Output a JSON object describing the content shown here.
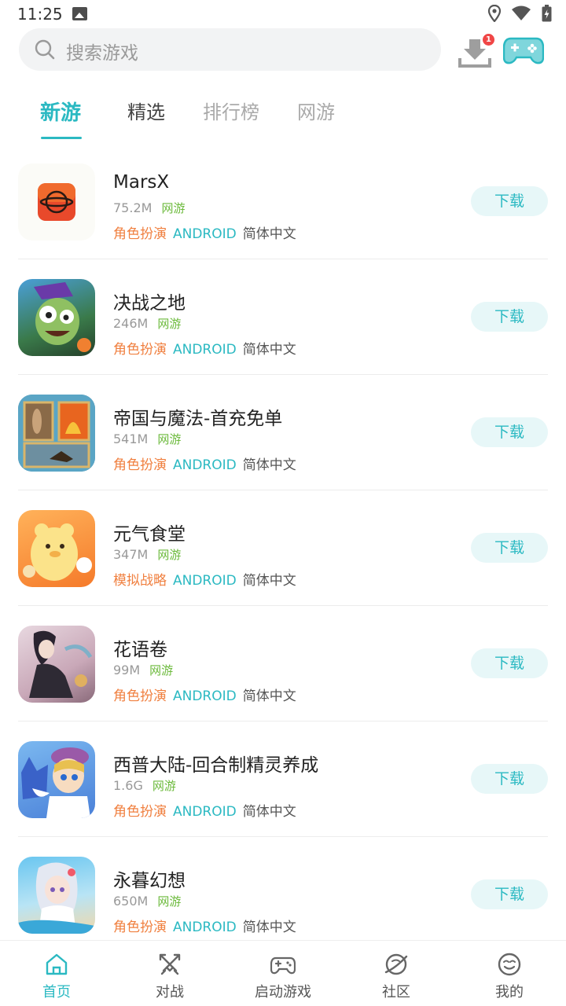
{
  "status_bar": {
    "time": "11:25"
  },
  "search": {
    "placeholder": "搜索游戏",
    "download_badge": "1"
  },
  "tabs": [
    {
      "label": "新游",
      "active": true
    },
    {
      "label": "精选",
      "active": false
    },
    {
      "label": "排行榜",
      "active": false
    },
    {
      "label": "网游",
      "active": false
    }
  ],
  "games": [
    {
      "name": "MarsX",
      "size": "75.2M",
      "kind": "网游",
      "genre": "角色扮演",
      "platform": "ANDROID",
      "language": "简体中文",
      "button": "下载"
    },
    {
      "name": "决战之地",
      "size": "246M",
      "kind": "网游",
      "genre": "角色扮演",
      "platform": "ANDROID",
      "language": "简体中文",
      "button": "下载"
    },
    {
      "name": "帝国与魔法-首充免单",
      "size": "541M",
      "kind": "网游",
      "genre": "角色扮演",
      "platform": "ANDROID",
      "language": "简体中文",
      "button": "下载"
    },
    {
      "name": "元气食堂",
      "size": "347M",
      "kind": "网游",
      "genre": "模拟战略",
      "platform": "ANDROID",
      "language": "简体中文",
      "button": "下载"
    },
    {
      "name": "花语卷",
      "size": "99M",
      "kind": "网游",
      "genre": "角色扮演",
      "platform": "ANDROID",
      "language": "简体中文",
      "button": "下载"
    },
    {
      "name": "西普大陆-回合制精灵养成",
      "size": "1.6G",
      "kind": "网游",
      "genre": "角色扮演",
      "platform": "ANDROID",
      "language": "简体中文",
      "button": "下载"
    },
    {
      "name": "永暮幻想",
      "size": "650M",
      "kind": "网游",
      "genre": "角色扮演",
      "platform": "ANDROID",
      "language": "简体中文",
      "button": "下载"
    }
  ],
  "bottom_nav": [
    {
      "label": "首页",
      "icon": "home-icon",
      "active": true
    },
    {
      "label": "对战",
      "icon": "swords-icon",
      "active": false
    },
    {
      "label": "启动游戏",
      "icon": "gamepad-icon",
      "active": false
    },
    {
      "label": "社区",
      "icon": "planet-icon",
      "active": false
    },
    {
      "label": "我的",
      "icon": "face-icon",
      "active": false
    }
  ],
  "colors": {
    "accent": "#2bb9c2",
    "genre": "#f08040",
    "kind": "#6cba3c",
    "badge": "#f04646"
  }
}
